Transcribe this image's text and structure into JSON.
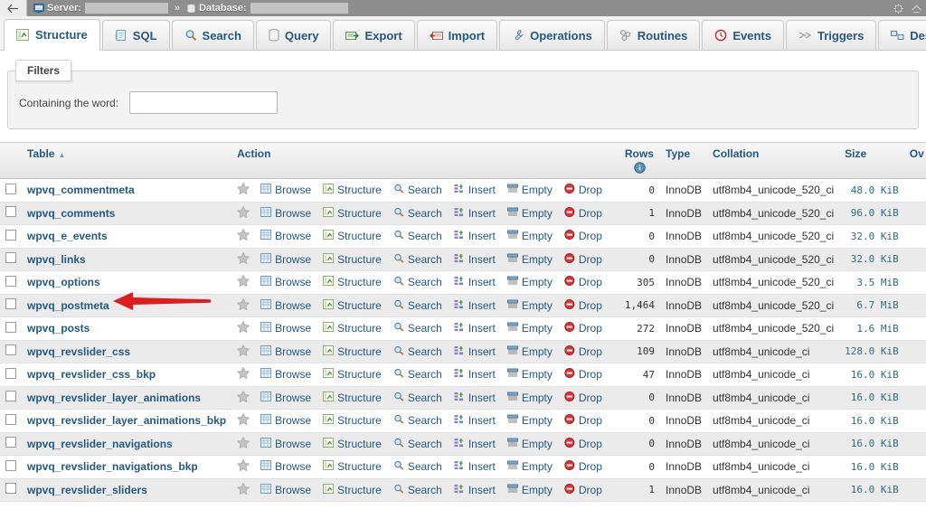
{
  "breadcrumb": {
    "back_icon": "back-arrow-icon",
    "server_icon": "server-icon",
    "server_label": "Server:",
    "server_value_redacted": true,
    "separator": "»",
    "database_icon": "database-icon",
    "database_label": "Database:",
    "database_value_redacted": true,
    "right_icons": [
      "gear-icon",
      "collapse-icon"
    ]
  },
  "tabs": [
    {
      "label": "Structure",
      "icon": "structure-icon",
      "active": true
    },
    {
      "label": "SQL",
      "icon": "sql-icon",
      "active": false
    },
    {
      "label": "Search",
      "icon": "search-icon",
      "active": false
    },
    {
      "label": "Query",
      "icon": "query-icon",
      "active": false
    },
    {
      "label": "Export",
      "icon": "export-icon",
      "active": false
    },
    {
      "label": "Import",
      "icon": "import-icon",
      "active": false
    },
    {
      "label": "Operations",
      "icon": "operations-icon",
      "active": false
    },
    {
      "label": "Routines",
      "icon": "routines-icon",
      "active": false
    },
    {
      "label": "Events",
      "icon": "events-icon",
      "active": false
    },
    {
      "label": "Triggers",
      "icon": "triggers-icon",
      "active": false
    },
    {
      "label": "Designer",
      "icon": "designer-icon",
      "active": false
    }
  ],
  "filters": {
    "legend": "Filters",
    "word_label": "Containing the word:",
    "word_value": "",
    "word_placeholder": ""
  },
  "table_headers": {
    "table": "Table",
    "sort_indicator": "▲",
    "action": "Action",
    "rows": "Rows",
    "rows_info_icon": "info-icon",
    "type": "Type",
    "collation": "Collation",
    "size": "Size",
    "overhead": "Ov"
  },
  "action_labels": {
    "favorite": "favorite-star-icon",
    "browse": "Browse",
    "structure": "Structure",
    "search": "Search",
    "insert": "Insert",
    "empty": "Empty",
    "drop": "Drop"
  },
  "annotation": {
    "type": "red-arrow",
    "color": "#e01b1b",
    "points_to": "wpvq_options"
  },
  "rows": [
    {
      "name": "wpvq_commentmeta",
      "rows": "0",
      "type": "InnoDB",
      "collation": "utf8mb4_unicode_520_ci",
      "size": "48.0 KiB",
      "overhead": ""
    },
    {
      "name": "wpvq_comments",
      "rows": "1",
      "type": "InnoDB",
      "collation": "utf8mb4_unicode_520_ci",
      "size": "96.0 KiB",
      "overhead": ""
    },
    {
      "name": "wpvq_e_events",
      "rows": "0",
      "type": "InnoDB",
      "collation": "utf8mb4_unicode_520_ci",
      "size": "32.0 KiB",
      "overhead": ""
    },
    {
      "name": "wpvq_links",
      "rows": "0",
      "type": "InnoDB",
      "collation": "utf8mb4_unicode_520_ci",
      "size": "32.0 KiB",
      "overhead": ""
    },
    {
      "name": "wpvq_options",
      "rows": "305",
      "type": "InnoDB",
      "collation": "utf8mb4_unicode_520_ci",
      "size": "3.5 MiB",
      "overhead": ""
    },
    {
      "name": "wpvq_postmeta",
      "rows": "1,464",
      "type": "InnoDB",
      "collation": "utf8mb4_unicode_520_ci",
      "size": "6.7 MiB",
      "overhead": ""
    },
    {
      "name": "wpvq_posts",
      "rows": "272",
      "type": "InnoDB",
      "collation": "utf8mb4_unicode_520_ci",
      "size": "1.6 MiB",
      "overhead": ""
    },
    {
      "name": "wpvq_revslider_css",
      "rows": "109",
      "type": "InnoDB",
      "collation": "utf8mb4_unicode_ci",
      "size": "128.0 KiB",
      "overhead": ""
    },
    {
      "name": "wpvq_revslider_css_bkp",
      "rows": "47",
      "type": "InnoDB",
      "collation": "utf8mb4_unicode_ci",
      "size": "16.0 KiB",
      "overhead": ""
    },
    {
      "name": "wpvq_revslider_layer_animations",
      "rows": "0",
      "type": "InnoDB",
      "collation": "utf8mb4_unicode_ci",
      "size": "16.0 KiB",
      "overhead": ""
    },
    {
      "name": "wpvq_revslider_layer_animations_bkp",
      "rows": "0",
      "type": "InnoDB",
      "collation": "utf8mb4_unicode_ci",
      "size": "16.0 KiB",
      "overhead": ""
    },
    {
      "name": "wpvq_revslider_navigations",
      "rows": "0",
      "type": "InnoDB",
      "collation": "utf8mb4_unicode_ci",
      "size": "16.0 KiB",
      "overhead": ""
    },
    {
      "name": "wpvq_revslider_navigations_bkp",
      "rows": "0",
      "type": "InnoDB",
      "collation": "utf8mb4_unicode_ci",
      "size": "16.0 KiB",
      "overhead": ""
    },
    {
      "name": "wpvq_revslider_sliders",
      "rows": "1",
      "type": "InnoDB",
      "collation": "utf8mb4_unicode_ci",
      "size": "16.0 KiB",
      "overhead": ""
    }
  ],
  "colors": {
    "link": "#235a81",
    "size_text": "#2f6d80",
    "topbar_bg": "#8e8e8e",
    "row_even": "#ebebeb",
    "annotation_red": "#e01b1b"
  }
}
